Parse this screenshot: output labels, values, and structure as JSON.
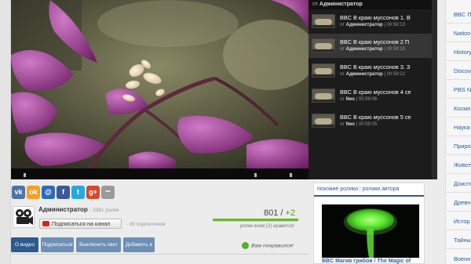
{
  "playlist": {
    "header_prefix": "от",
    "header_author": "Администратор",
    "items": [
      {
        "title": "BBC В краю муссонов 1. В",
        "by": "от",
        "author": "Администратор",
        "duration": "00:59:13",
        "active": false
      },
      {
        "title": "BBC В краю муссонов 2 П",
        "by": "от",
        "author": "Администратор",
        "duration": "00:59:10",
        "active": true
      },
      {
        "title": "BBC В краю муссонов 3. З",
        "by": "от",
        "author": "Администратор",
        "duration": "00:59:22",
        "active": false
      },
      {
        "title": "BBC В краю муссонов 4 се",
        "by": "от",
        "author": "Neo",
        "duration": "00:59:06",
        "active": false
      },
      {
        "title": "BBC В краю муссонов 5 се",
        "by": "от",
        "author": "Neo",
        "duration": "00:59:05",
        "active": false
      }
    ]
  },
  "categories": [
    "BBC П",
    "Nation",
    "History",
    "Discov",
    "PBS N",
    "Космо",
    "Наука",
    "Приро",
    "Живот",
    "Доисто",
    "Древн",
    "Истор",
    "Тайны",
    "Военн"
  ],
  "share": {
    "buttons": [
      {
        "name": "vk-icon",
        "glyph": "vk",
        "color": "#4c75a3"
      },
      {
        "name": "odnoklassniki-icon",
        "glyph": "ok",
        "color": "#f5a023"
      },
      {
        "name": "mailru-icon",
        "glyph": "@",
        "color": "#2c6bb5"
      },
      {
        "name": "facebook-icon",
        "glyph": "f",
        "color": "#3b5998"
      },
      {
        "name": "twitter-icon",
        "glyph": "t",
        "color": "#27a8e0"
      },
      {
        "name": "googleplus-icon",
        "glyph": "g+",
        "color": "#d6492f"
      },
      {
        "name": "more-icon",
        "glyph": "•••",
        "color": "#9a9a9a"
      }
    ]
  },
  "channel": {
    "name": "Администратор",
    "views": "· 3381 ролик",
    "subscribe_label": "Подписаться на канал",
    "subscribers": "· 39 подписчиков"
  },
  "rating": {
    "views": "801",
    "sep": " / ",
    "plus": "+2",
    "text": "ролик всем (2) нравится!",
    "like_fraction": 1.0
  },
  "tabs": [
    "О видео",
    "Подписаться",
    "Выключить свет",
    "Добавить в"
  ],
  "like_message": "Вам понравился!",
  "related": {
    "tab1": "похожие ролики",
    "sep": "|",
    "tab2": "ролики автора",
    "title": "BBC Магия грибов / The Magic of"
  },
  "colors": {
    "accent": "#2e5a8c",
    "button": "#6e8fb4",
    "link": "#2b5c9a",
    "rating_green": "#6aba2c"
  }
}
